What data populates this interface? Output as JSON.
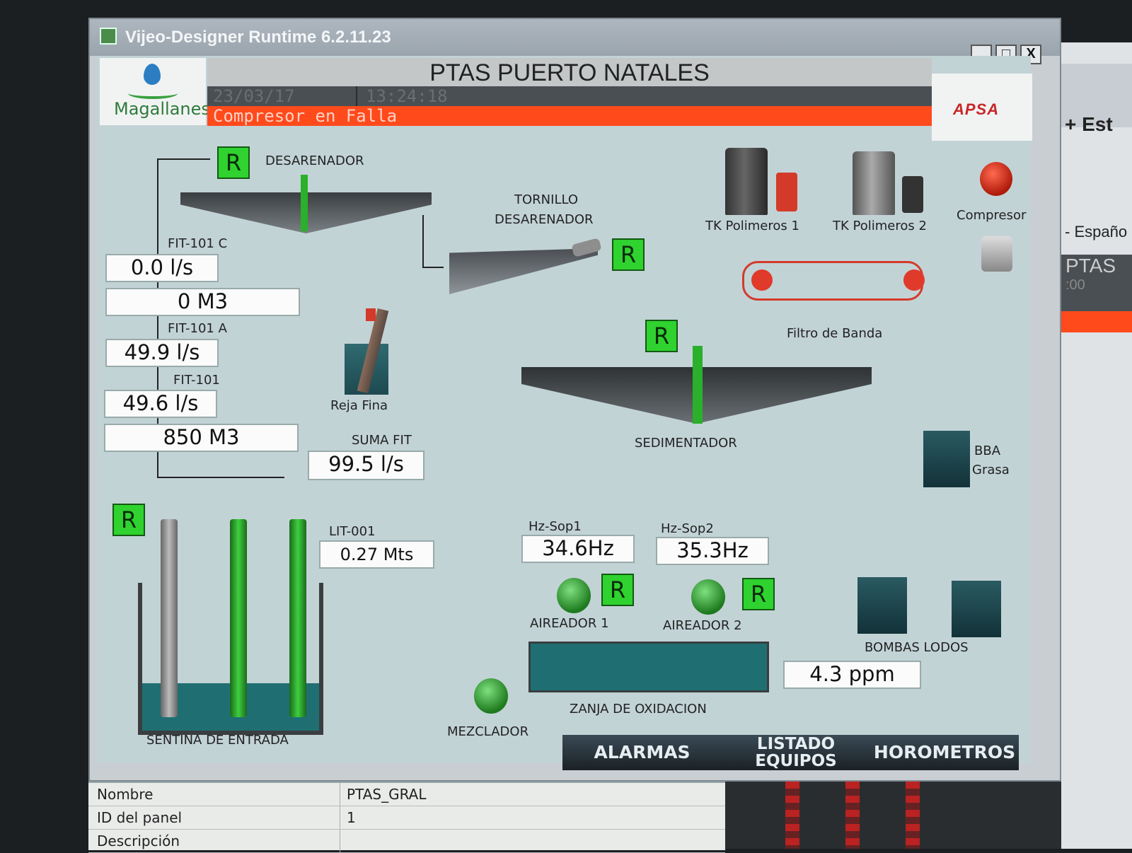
{
  "window": {
    "title": "Vijeo-Designer Runtime 6.2.11.23",
    "buttons": [
      "_",
      "□",
      "X"
    ]
  },
  "header": {
    "title": "PTAS PUERTO NATALES",
    "date": "23/03/17",
    "time": "13:24:18",
    "alarm": "Compresor en Falla"
  },
  "logos": {
    "left": "Magallanes",
    "right": "APSA"
  },
  "plant": {
    "desarenador": "DESARENADOR",
    "tornillo_line1": "TORNILLO",
    "tornillo_line2": "DESARENADOR",
    "tk1": "TK Polimeros 1",
    "tk2": "TK Polimeros 2",
    "compresor": "Compresor",
    "filtro": "Filtro de Banda",
    "reja": "Reja Fina",
    "sedimentador": "SEDIMENTADOR",
    "bba_line1": "BBA",
    "bba_line2": "Grasa",
    "sentina": "SENTINA DE ENTRADA",
    "mezclador": "MEZCLADOR",
    "zanja": "ZANJA DE OXIDACION",
    "aireador1": "AIREADOR 1",
    "aireador2": "AIREADOR 2",
    "bombas": "BOMBAS LODOS",
    "run_label": "R"
  },
  "measurements": {
    "fit101c_label": "FIT-101 C",
    "fit101c_flow": "0.0 l/s",
    "fit101c_total": "0 M3",
    "fit101a_label": "FIT-101 A",
    "fit101a_flow": "49.9 l/s",
    "fit101_label": "FIT-101",
    "fit101_flow": "49.6 l/s",
    "fit101_total": "850 M3",
    "suma_label": "SUMA FIT",
    "suma_value": "99.5 l/s",
    "lit_label": "LIT-001",
    "lit_value": "0.27 Mts",
    "hz1_label": "Hz-Sop1",
    "hz1_value": "34.6Hz",
    "hz2_label": "Hz-Sop2",
    "hz2_value": "35.3Hz",
    "ppm_value": "4.3 ppm"
  },
  "nav": {
    "alarmas": "ALARMAS",
    "listado_1": "LISTADO",
    "listado_2": "EQUIPOS",
    "horometros": "HOROMETROS"
  },
  "properties": [
    {
      "key": "Nombre",
      "value": "PTAS_GRAL"
    },
    {
      "key": "ID del panel",
      "value": "1"
    },
    {
      "key": "Descripción",
      "value": ""
    }
  ],
  "background_window": {
    "plus": "+ Est",
    "lang": "- Españo",
    "ptas": "PTAS",
    "time_frag": ":00"
  }
}
